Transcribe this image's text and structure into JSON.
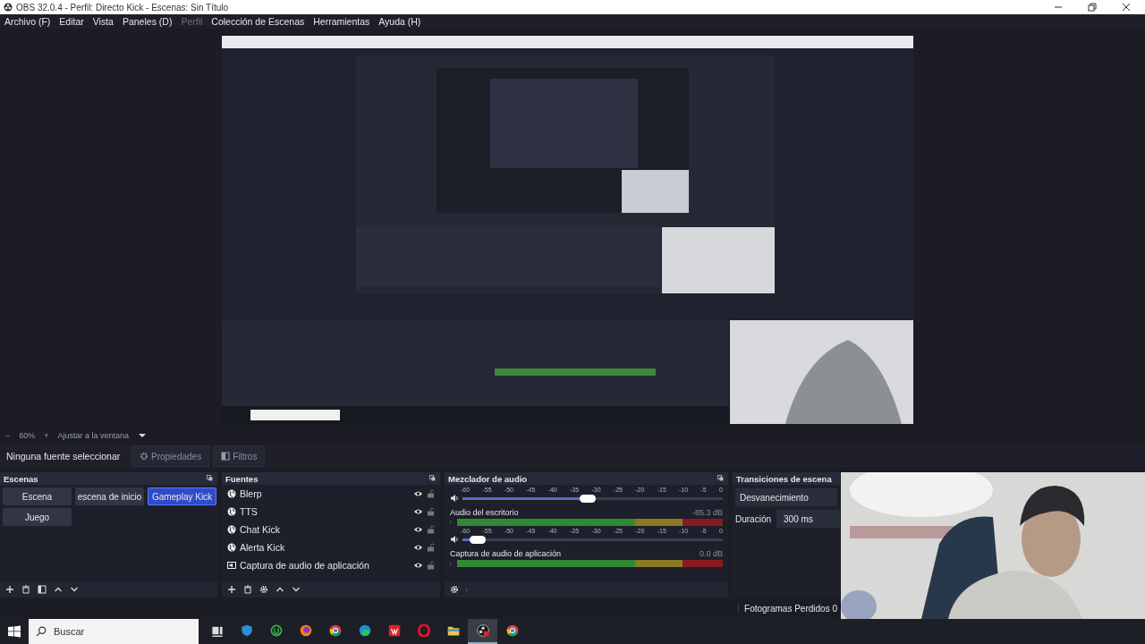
{
  "window": {
    "title": "OBS 32.0.4 - Perfil: Directo Kick - Escenas: Sin Título"
  },
  "menu": [
    {
      "label": "Archivo (F)",
      "disabled": false
    },
    {
      "label": "Editar",
      "disabled": false
    },
    {
      "label": "Vista",
      "disabled": false
    },
    {
      "label": "Paneles (D)",
      "disabled": false
    },
    {
      "label": "Perfil",
      "disabled": true
    },
    {
      "label": "Colección de Escenas",
      "disabled": false
    },
    {
      "label": "Herramientas",
      "disabled": false
    },
    {
      "label": "Ayuda (H)",
      "disabled": false
    }
  ],
  "zoom_bar": {
    "minus": "−",
    "zoom": "60%",
    "plus": "+",
    "fit": "Ajustar a la ventana"
  },
  "context_bar": {
    "selection": "Ninguna fuente seleccionar",
    "properties": "Propiedades",
    "filters": "Filtros"
  },
  "scenes": {
    "title": "Escenas",
    "items": [
      {
        "label": "Escena",
        "selected": false
      },
      {
        "label": "escena de inicio",
        "selected": false
      },
      {
        "label": "Gameplay Kick",
        "selected": true
      },
      {
        "label": "Juego",
        "selected": false
      }
    ]
  },
  "sources": {
    "title": "Fuentes",
    "items": [
      {
        "name": "Blerp",
        "kind": "browser",
        "visible": true,
        "locked": false
      },
      {
        "name": "TTS",
        "kind": "browser",
        "visible": true,
        "locked": false
      },
      {
        "name": "Chat Kick",
        "kind": "browser",
        "visible": true,
        "locked": false
      },
      {
        "name": "Alerta Kick",
        "kind": "browser",
        "visible": true,
        "locked": false
      },
      {
        "name": "Captura de audio de aplicación",
        "kind": "audio",
        "visible": true,
        "locked": false
      }
    ]
  },
  "mixer": {
    "title": "Mezclador de audio",
    "channels": [
      {
        "ticks": [
          "-60",
          "-55",
          "-50",
          "-45",
          "-40",
          "-35",
          "-30",
          "-25",
          "-20",
          "-15",
          "-10",
          "-5",
          "0"
        ],
        "level": 0.48
      },
      {
        "name": "Audio del escritorio",
        "reading": "-85.3 dB",
        "ticks": [
          "-60",
          "-55",
          "-50",
          "-45",
          "-40",
          "-35",
          "-30",
          "-25",
          "-20",
          "-15",
          "-10",
          "-5",
          "0"
        ],
        "level": 0.06
      },
      {
        "name": "Captura de audio de aplicación",
        "reading": "0.0 dB"
      }
    ]
  },
  "transitions": {
    "title": "Transiciones de escena",
    "selected": "Desvanecimiento",
    "duration_label": "Duración",
    "duration": "300 ms"
  },
  "status_bar": {
    "dropped_frames": "Fotogramas Perdidos 0"
  },
  "taskbar": {
    "search": {
      "placeholder": "Buscar"
    },
    "apps": [
      {
        "kind": "task-view",
        "active": false
      },
      {
        "kind": "shield",
        "active": false
      },
      {
        "kind": "ring",
        "active": false
      },
      {
        "kind": "firefox",
        "active": false
      },
      {
        "kind": "chrome",
        "active": false
      },
      {
        "kind": "edge",
        "active": false
      },
      {
        "kind": "document",
        "active": false
      },
      {
        "kind": "opera",
        "active": false
      },
      {
        "kind": "folder",
        "active": false
      },
      {
        "kind": "obs",
        "active": true
      },
      {
        "kind": "chrome",
        "active": false
      }
    ]
  }
}
